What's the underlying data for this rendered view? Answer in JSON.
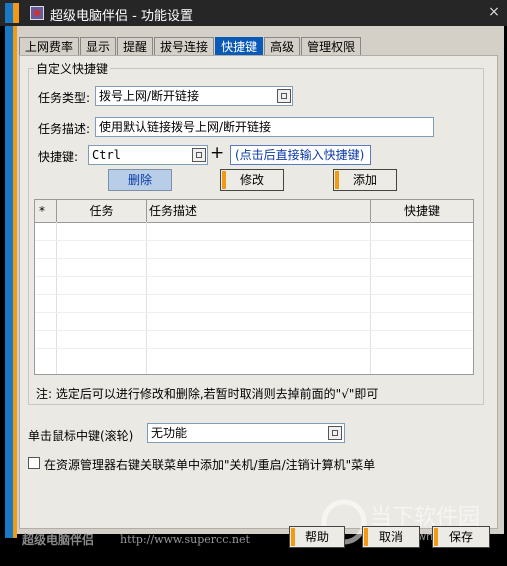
{
  "window": {
    "title": "超级电脑伴侣 - 功能设置",
    "close_glyph": "×"
  },
  "tabs": [
    {
      "label": "上网费率",
      "active": false
    },
    {
      "label": "显示",
      "active": false
    },
    {
      "label": "提醒",
      "active": false
    },
    {
      "label": "拔号连接",
      "active": false
    },
    {
      "label": "快捷键",
      "active": true
    },
    {
      "label": "高级",
      "active": false
    },
    {
      "label": "管理权限",
      "active": false
    }
  ],
  "shortcut_group": {
    "title": "自定义快捷键",
    "task_type_label": "任务类型:",
    "task_type_value": "拨号上网/断开链接",
    "task_desc_label": "任务描述:",
    "task_desc_value": "使用默认链接拨号上网/断开链接",
    "hotkey_label": "快捷键:",
    "hotkey_value": "Ctrl",
    "plus_sign": "+",
    "hotkey_hint": "(点击后直接输入快捷键)",
    "delete_button": "删除",
    "modify_button": "修改",
    "add_button": "添加"
  },
  "table": {
    "columns": [
      "*",
      "任务",
      "任务描述",
      "快捷键"
    ],
    "rows": []
  },
  "note": "注: 选定后可以进行修改和删除,若暂时取消则去掉前面的\"√\"即可",
  "middle_click": {
    "label": "单击鼠标中键(滚轮)",
    "value": "无功能"
  },
  "context_menu_option": {
    "label": "在资源管理器右键关联菜单中添加\"关机/重启/注销计算机\"菜单",
    "checked": false
  },
  "footer": {
    "brand": "超级电脑伴侣",
    "url": "http://www.supercc.net",
    "help_button": "帮助",
    "cancel_button": "取消",
    "save_button": "保存"
  },
  "watermark": {
    "text_cn": "当下软件园",
    "text_en": "www.downxia.com"
  },
  "colors": {
    "accent_blue": "#1a79c7",
    "accent_orange": "#f29a16",
    "active_tab": "#0a59b7"
  }
}
